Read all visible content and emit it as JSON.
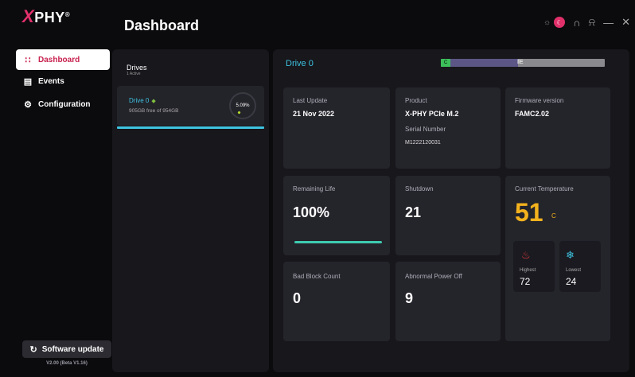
{
  "app": {
    "logo_text": "PHY",
    "logo_mark": "X",
    "logo_reg": "®"
  },
  "sidebar": {
    "items": [
      {
        "label": "Dashboard",
        "icon": "grid-icon",
        "active": true
      },
      {
        "label": "Events",
        "icon": "calendar-icon",
        "active": false
      },
      {
        "label": "Configuration",
        "icon": "gear-icon",
        "active": false
      }
    ],
    "software_update_label": "Software update",
    "version": "V2.00 (Beta V1.16)"
  },
  "header": {
    "title": "Dashboard"
  },
  "drives": {
    "title": "Drives",
    "subtitle": "1 Active",
    "list": [
      {
        "name": "Drive 0",
        "free_text": "905GB free of 954GB",
        "used_percent": "5.09%"
      }
    ]
  },
  "main": {
    "drive_title": "Drive 0",
    "usage_bar": {
      "segment_label": "C",
      "marker": "‖E"
    },
    "last_update": {
      "label": "Last Update",
      "value": "21 Nov 2022"
    },
    "product": {
      "label": "Product",
      "value": "X-PHY PCIe M.2",
      "serial_label": "Serial Number",
      "serial_value": "M1222120031"
    },
    "firmware": {
      "label": "Firmware version",
      "value": "FAMC2.02"
    },
    "remaining_life": {
      "label": "Remaining Life",
      "value": "100%",
      "percent": 100
    },
    "shutdown": {
      "label": "Shutdown",
      "value": "21"
    },
    "temperature": {
      "label": "Current Temperature",
      "value": "51",
      "unit": "C",
      "highest_label": "Highest",
      "highest_value": "72",
      "lowest_label": "Lowest",
      "lowest_value": "24"
    },
    "bad_block": {
      "label": "Bad Block Count",
      "value": "0"
    },
    "abnormal_power": {
      "label": "Abnormal Power Off",
      "value": "9"
    }
  },
  "colors": {
    "accent": "#e0306a",
    "drive_accent": "#3ec3e0",
    "temp": "#f3b21d",
    "life_bar": "#3ecbb0"
  }
}
